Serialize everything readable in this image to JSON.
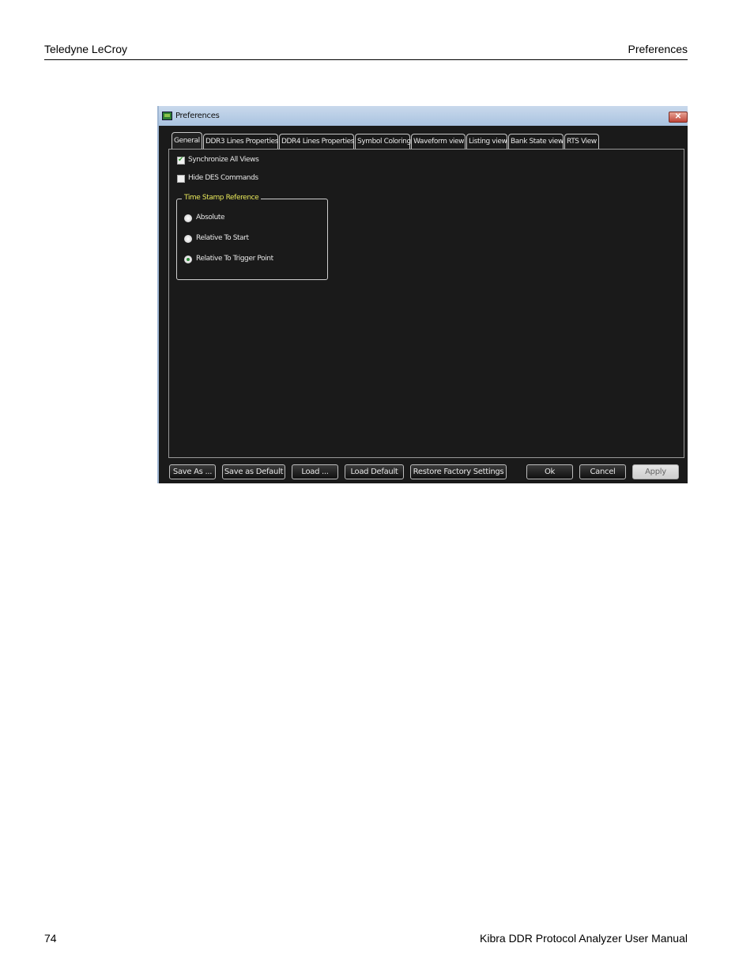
{
  "page": {
    "header_left": "Teledyne LeCroy",
    "header_right": "Preferences",
    "footer_page_number": "74",
    "footer_title": "Kibra DDR Protocol Analyzer User Manual"
  },
  "dialog": {
    "title": "Preferences",
    "close_glyph": "✕",
    "tabs": [
      {
        "label": "General",
        "active": true
      },
      {
        "label": "DDR3 Lines Properties"
      },
      {
        "label": "DDR4 Lines Properties"
      },
      {
        "label": "Symbol Coloring"
      },
      {
        "label": "Waveform view"
      },
      {
        "label": "Listing view"
      },
      {
        "label": "Bank State view"
      },
      {
        "label": "RTS View"
      }
    ],
    "general": {
      "synchronize_all_views": {
        "label": "Synchronize All Views",
        "checked": true
      },
      "hide_des_commands": {
        "label": "Hide DES Commands",
        "checked": false
      },
      "time_stamp_reference": {
        "title": "Time Stamp Reference",
        "options": [
          {
            "label": "Absolute",
            "selected": false
          },
          {
            "label": "Relative To Start",
            "selected": false
          },
          {
            "label": "Relative To Trigger Point",
            "selected": true
          }
        ]
      }
    },
    "buttons": {
      "save_as": "Save As ...",
      "save_as_default": "Save as Default",
      "load": "Load ...",
      "load_default": "Load Default",
      "restore_factory": "Restore Factory Settings",
      "ok": "Ok",
      "cancel": "Cancel",
      "apply": "Apply"
    }
  }
}
